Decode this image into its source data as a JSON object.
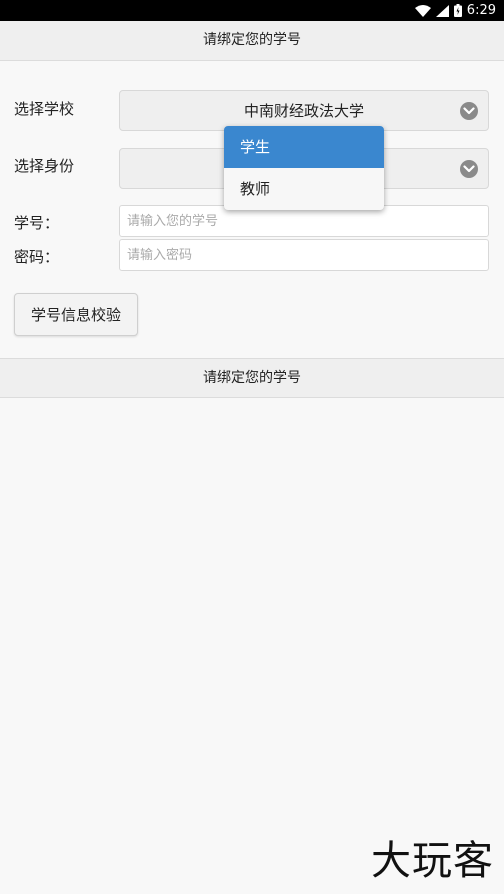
{
  "status_bar": {
    "time": "6:29",
    "icons": [
      "wifi-icon",
      "cellular-signal-icon",
      "battery-icon"
    ]
  },
  "header": {
    "title": "请绑定您的学号"
  },
  "form": {
    "school_label": "选择学校",
    "school_value": "中南财经政法大学",
    "identity_label": "选择身份",
    "identity_value": "",
    "student_id_label": "学号：",
    "student_id_placeholder": "请输入您的学号",
    "student_id_value": "",
    "password_label": "密码：",
    "password_placeholder": "请输入密码",
    "password_value": "",
    "verify_button_label": "学号信息校验"
  },
  "identity_dropdown": {
    "options": [
      {
        "label": "学生",
        "selected": true
      },
      {
        "label": "教师",
        "selected": false
      }
    ]
  },
  "section_bar": {
    "title": "请绑定您的学号"
  },
  "watermark": "大玩客",
  "colors": {
    "status_bar": "#000000",
    "header_bg": "#efefef",
    "selected_option": "#3a87cf",
    "page_bg": "#f8f8f8"
  }
}
